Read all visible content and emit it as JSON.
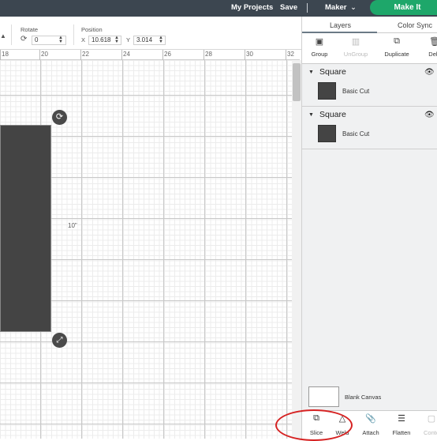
{
  "topbar": {
    "my_projects": "My Projects",
    "save": "Save",
    "separator": "|",
    "machine": "Maker",
    "make_it": "Make It",
    "chevron": "chevron-down-icon"
  },
  "toolbar": {
    "rotate_label": "Rotate",
    "rotate_value": "0",
    "position_label": "Position",
    "x_label": "X",
    "x_value": "10.618",
    "y_label": "Y",
    "y_value": "3.014"
  },
  "ruler": {
    "ticks": [
      "18",
      "20",
      "22",
      "24",
      "26",
      "28",
      "30",
      "32"
    ]
  },
  "canvas": {
    "label": "10\""
  },
  "panel": {
    "tabs": [
      "Layers",
      "Color Sync"
    ],
    "actions": [
      {
        "label": "Group",
        "icon": "group-icon"
      },
      {
        "label": "UnGroup",
        "icon": "ungroup-icon"
      },
      {
        "label": "Duplicate",
        "icon": "duplicate-icon"
      },
      {
        "label": "Dele",
        "icon": "delete-icon"
      }
    ],
    "layers": [
      {
        "name": "Square",
        "sub": "Basic Cut",
        "color": "#444444"
      },
      {
        "name": "Square",
        "sub": "Basic Cut",
        "color": "#444444"
      }
    ],
    "blank_canvas": "Blank Canvas",
    "bottom_actions": [
      {
        "label": "Slice",
        "icon": "slice-icon"
      },
      {
        "label": "Weld",
        "icon": "weld-icon"
      },
      {
        "label": "Attach",
        "icon": "attach-icon"
      },
      {
        "label": "Flatten",
        "icon": "flatten-icon"
      },
      {
        "label": "Conto",
        "icon": "contour-icon"
      }
    ]
  },
  "colors": {
    "topbar": "#3c4650",
    "make_it": "#1ea76a",
    "shape": "#444444",
    "highlight": "#d62222"
  }
}
